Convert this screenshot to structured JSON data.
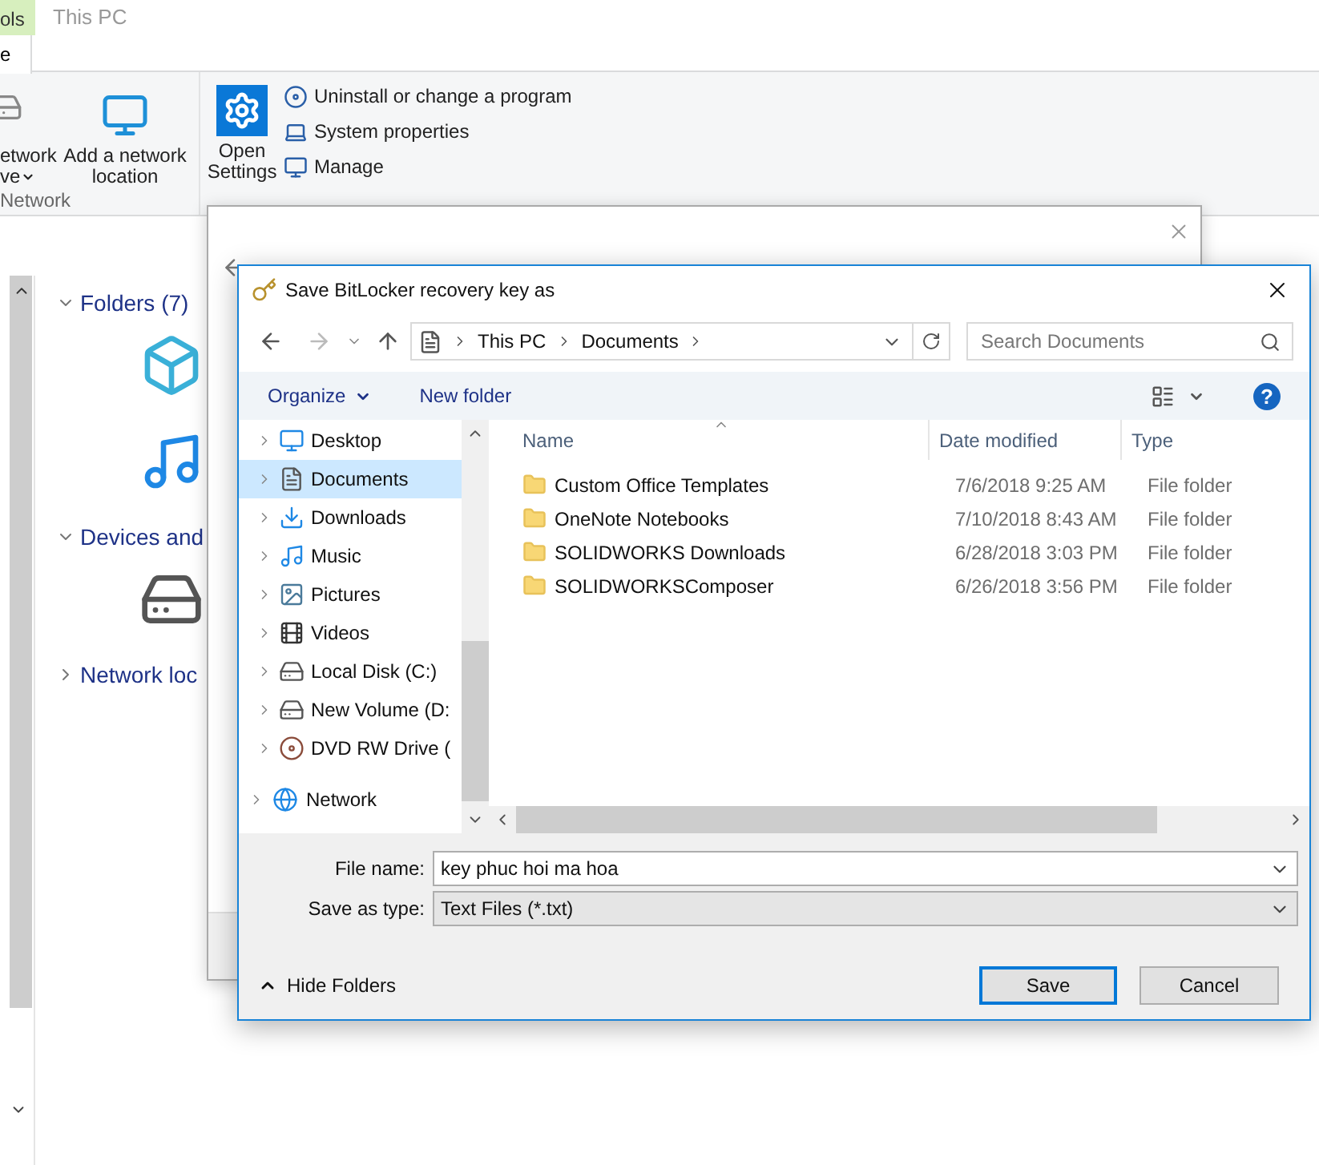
{
  "explorer": {
    "contextual_tab": "ols",
    "window_title": "This PC",
    "tabs": [
      {
        "label": "e",
        "selected": true
      }
    ],
    "ribbon": {
      "network_group": {
        "label": "Network",
        "map_drive": [
          "etwork",
          "ve"
        ],
        "add_location": [
          "Add a network",
          "location"
        ]
      },
      "system_group": {
        "open_settings": [
          "Open",
          "Settings"
        ],
        "items": [
          {
            "label": "Uninstall or change a program",
            "kind": "program"
          },
          {
            "label": "System properties",
            "kind": "properties"
          },
          {
            "label": "Manage",
            "kind": "manage"
          }
        ]
      }
    },
    "sections": [
      {
        "title": "Folders (7)",
        "expanded": true,
        "items": [
          {
            "kind": "objects"
          },
          {
            "kind": "music"
          }
        ]
      },
      {
        "title": "Devices and",
        "expanded": true,
        "items": [
          {
            "kind": "windows-drive"
          }
        ]
      },
      {
        "title": "Network loc",
        "expanded": false
      }
    ]
  },
  "dialog": {
    "title": "Save BitLocker recovery key as",
    "breadcrumb": [
      "This PC",
      "Documents"
    ],
    "search": {
      "placeholder": "Search Documents"
    },
    "toolbar": {
      "organize": "Organize",
      "new_folder": "New folder",
      "help": "?"
    },
    "tree": [
      {
        "label": "Desktop",
        "kind": "desktop",
        "selected": false
      },
      {
        "label": "Documents",
        "kind": "documents",
        "selected": true
      },
      {
        "label": "Downloads",
        "kind": "downloads",
        "selected": false
      },
      {
        "label": "Music",
        "kind": "music",
        "selected": false
      },
      {
        "label": "Pictures",
        "kind": "pictures",
        "selected": false
      },
      {
        "label": "Videos",
        "kind": "videos",
        "selected": false
      },
      {
        "label": "Local Disk (C:)",
        "kind": "disk",
        "selected": false
      },
      {
        "label": "New Volume (D:",
        "kind": "drive",
        "selected": false
      },
      {
        "label": "DVD RW Drive (",
        "kind": "dvd",
        "selected": false
      }
    ],
    "network": {
      "label": "Network",
      "selected": false
    },
    "columns": [
      "Name",
      "Date modified",
      "Type"
    ],
    "rows": [
      {
        "name": "Custom Office Templates",
        "date": "7/6/2018 9:25 AM",
        "type": "File folder"
      },
      {
        "name": "OneNote Notebooks",
        "date": "7/10/2018 8:43 AM",
        "type": "File folder"
      },
      {
        "name": "SOLIDWORKS Downloads",
        "date": "6/28/2018 3:03 PM",
        "type": "File folder"
      },
      {
        "name": "SOLIDWORKSComposer",
        "date": "6/26/2018 3:56 PM",
        "type": "File folder"
      }
    ],
    "file_name": {
      "label": "File name:",
      "value": "key phuc hoi ma hoa"
    },
    "save_as_type": {
      "label": "Save as type:",
      "value": "Text Files (*.txt)"
    },
    "hide_folders": "Hide Folders",
    "buttons": {
      "save": "Save",
      "cancel": "Cancel"
    }
  }
}
